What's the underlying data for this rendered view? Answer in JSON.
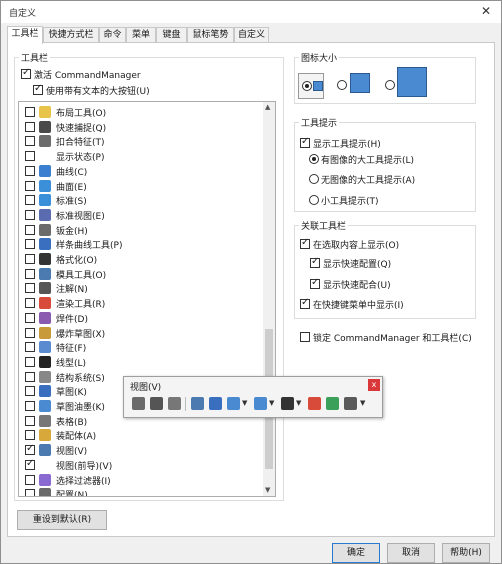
{
  "window": {
    "title": "自定义",
    "close_glyph": "✕"
  },
  "tabs": [
    "工具栏",
    "快捷方式栏",
    "命令",
    "菜单",
    "键盘",
    "鼠标笔势",
    "自定义"
  ],
  "toolbars_group": {
    "legend": "工具栏",
    "activate_cm": "激活 CommandManager",
    "use_large_text": "使用带有文本的大按钮(U)",
    "items": [
      {
        "label": "布局工具(O)",
        "checked": false,
        "color": "#e8c44a"
      },
      {
        "label": "快速捕捉(Q)",
        "checked": false,
        "color": "#4a4a4a"
      },
      {
        "label": "扣合特征(T)",
        "checked": false,
        "color": "#6c6c6c"
      },
      {
        "label": "显示状态(P)",
        "checked": false,
        "color": ""
      },
      {
        "label": "曲线(C)",
        "checked": false,
        "color": "#3a7fd0"
      },
      {
        "label": "曲面(E)",
        "checked": false,
        "color": "#3a8fd8"
      },
      {
        "label": "标准(S)",
        "checked": false,
        "color": "#3a8fd8"
      },
      {
        "label": "标准视图(E)",
        "checked": false,
        "color": "#5a6bb0"
      },
      {
        "label": "钣金(H)",
        "checked": false,
        "color": "#6b6b6b"
      },
      {
        "label": "样条曲线工具(P)",
        "checked": false,
        "color": "#3a6fc0"
      },
      {
        "label": "格式化(O)",
        "checked": false,
        "color": "#333333"
      },
      {
        "label": "模具工具(O)",
        "checked": false,
        "color": "#4a7ab0"
      },
      {
        "label": "注解(N)",
        "checked": false,
        "color": "#555555"
      },
      {
        "label": "渲染工具(R)",
        "checked": false,
        "color": "#d84a3a"
      },
      {
        "label": "焊件(D)",
        "checked": false,
        "color": "#8a5ab0"
      },
      {
        "label": "爆炸草图(X)",
        "checked": false,
        "color": "#c89a3a"
      },
      {
        "label": "特征(F)",
        "checked": false,
        "color": "#5a8ad0"
      },
      {
        "label": "线型(L)",
        "checked": false,
        "color": "#222222"
      },
      {
        "label": "结构系统(S)",
        "checked": false,
        "color": "#888888"
      },
      {
        "label": "草图(K)",
        "checked": false,
        "color": "#3a6fc0"
      },
      {
        "label": "草图油墨(K)",
        "checked": false,
        "color": "#4a8ad0"
      },
      {
        "label": "表格(B)",
        "checked": false,
        "color": "#777777"
      },
      {
        "label": "装配体(A)",
        "checked": false,
        "color": "#d8a83a"
      },
      {
        "label": "视图(V)",
        "checked": true,
        "color": "#4a7ab0"
      },
      {
        "label": "视图(前导)(V)",
        "checked": true,
        "color": ""
      },
      {
        "label": "选择过滤器(I)",
        "checked": false,
        "color": "#8a6ad0"
      },
      {
        "label": "配置(N)",
        "checked": false,
        "color": "#6a6a6a"
      }
    ],
    "reset_button": "重设到默认(R)"
  },
  "icon_size": {
    "legend": "图标大小",
    "options": [
      "small",
      "medium",
      "large"
    ],
    "selected": "small"
  },
  "tooltips": {
    "legend": "工具提示",
    "show": "显示工具提示(H)",
    "options": [
      "有图像的大工具提示(L)",
      "无图像的大工具提示(A)",
      "小工具提示(T)"
    ],
    "selected": 0
  },
  "related": {
    "legend": "关联工具栏",
    "show_in_selection": "在选取内容上显示(O)",
    "show_quick_config": "显示快速配置(Q)",
    "show_quick_mate": "显示快速配合(U)",
    "show_in_shortcut": "在快捷键菜单中显示(I)"
  },
  "lock_cm": "锁定 CommandManager 和工具栏(C)",
  "view_toolbar": {
    "title": "视图(V)",
    "close_glyph": "x"
  },
  "footer": {
    "ok": "确定",
    "cancel": "取消",
    "help": "帮助(H)"
  }
}
